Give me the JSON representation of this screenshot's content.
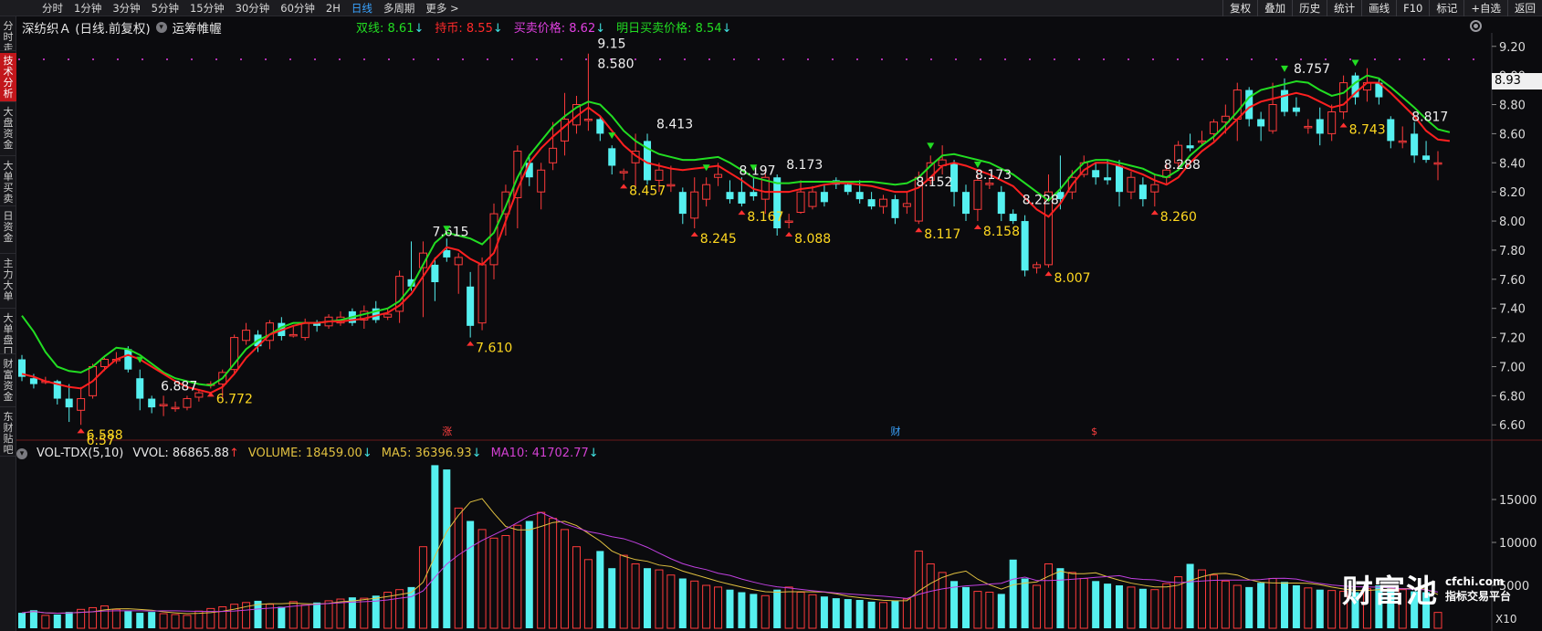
{
  "topbar": {
    "periods": [
      "分时",
      "1分钟",
      "3分钟",
      "5分钟",
      "15分钟",
      "30分钟",
      "60分钟",
      "2H",
      "日线",
      "多周期",
      "更多 >"
    ],
    "active_period": "日线",
    "tools": [
      "复权",
      "叠加",
      "历史",
      "统计",
      "画线",
      "F10",
      "标记",
      "+自选",
      "返回"
    ]
  },
  "sidebar": {
    "tabs": [
      "分时走势",
      "技术分析",
      "大盘资金",
      "大单买卖",
      "日资金",
      "主力大单",
      "大单盘口",
      "财富资金",
      "东财贴吧"
    ],
    "active": "技术分析"
  },
  "header": {
    "stock_title": "深纺织Ａ (日线.前复权)",
    "indicator_name": "运筹帷幄",
    "indicators": [
      {
        "label": "双线:",
        "value": "8.61",
        "arrow": "↓",
        "color": "#22dd22"
      },
      {
        "label": "持币:",
        "value": "8.55",
        "arrow": "↓",
        "color": "#ff2a2a"
      },
      {
        "label": "买卖价格:",
        "value": "8.62",
        "arrow": "↓",
        "color": "#e040e0"
      },
      {
        "label": "明日买卖价格:",
        "value": "8.54",
        "arrow": "↓",
        "color": "#22dd22"
      }
    ]
  },
  "volume_header": {
    "name": "VOL-TDX(5,10)",
    "vvol": "VVOL: 86865.88",
    "vvol_arrow": "↑",
    "volume": "VOLUME: 18459.00",
    "volume_arrow": "↓",
    "ma5": "MA5: 36396.93",
    "ma5_arrow": "↓",
    "ma10": "MA10: 41702.77",
    "ma10_arrow": "↓"
  },
  "current_price_tag": "8.93",
  "x10_label": "X10",
  "watermark": {
    "logo": "财富池",
    "domain": "cfchi.com",
    "subtitle": "指标交易平台"
  },
  "event_markers": [
    "涨",
    "财",
    "$"
  ],
  "colors": {
    "up": "#ff3b3b",
    "down": "#55f0f0",
    "green_line": "#22dd22",
    "red_line": "#ff2020",
    "ma5": "#e0c040",
    "ma10": "#c040e0"
  },
  "chart_data": [
    {
      "type": "candlestick",
      "title": "",
      "y_ticks": [
        "9.20",
        "9.00",
        "8.80",
        "8.60",
        "8.40",
        "8.20",
        "8.00",
        "7.80",
        "7.60",
        "7.40",
        "7.20",
        "7.00",
        "6.80",
        "6.60"
      ],
      "ylim": [
        6.52,
        9.28
      ],
      "candles": [
        [
          7.05,
          6.93,
          6.9,
          7.08
        ],
        [
          6.92,
          6.88,
          6.85,
          6.95
        ],
        [
          6.9,
          6.9,
          6.88,
          6.93
        ],
        [
          6.9,
          6.78,
          6.74,
          6.91
        ],
        [
          6.78,
          6.72,
          6.62,
          6.88
        ],
        [
          6.7,
          6.78,
          6.6,
          6.86
        ],
        [
          6.8,
          7.0,
          6.78,
          7.02
        ],
        [
          7.0,
          7.05,
          6.97,
          7.06
        ],
        [
          7.05,
          7.05,
          7.02,
          7.1
        ],
        [
          7.12,
          6.98,
          6.96,
          7.14
        ],
        [
          6.92,
          6.78,
          6.7,
          6.98
        ],
        [
          6.78,
          6.72,
          6.68,
          6.8
        ],
        [
          6.74,
          6.74,
          6.66,
          6.8
        ],
        [
          6.72,
          6.72,
          6.69,
          6.76
        ],
        [
          6.72,
          6.78,
          6.7,
          6.8
        ],
        [
          6.79,
          6.82,
          6.76,
          6.84
        ],
        [
          6.88,
          6.88,
          6.85,
          6.9
        ],
        [
          6.88,
          6.96,
          6.78,
          6.98
        ],
        [
          6.98,
          7.2,
          6.95,
          7.22
        ],
        [
          7.18,
          7.25,
          7.15,
          7.3
        ],
        [
          7.22,
          7.14,
          7.1,
          7.25
        ],
        [
          7.18,
          7.3,
          7.12,
          7.32
        ],
        [
          7.3,
          7.21,
          7.18,
          7.34
        ],
        [
          7.22,
          7.22,
          7.2,
          7.28
        ],
        [
          7.2,
          7.3,
          7.18,
          7.33
        ],
        [
          7.3,
          7.28,
          7.24,
          7.32
        ],
        [
          7.28,
          7.34,
          7.26,
          7.36
        ],
        [
          7.3,
          7.34,
          7.28,
          7.38
        ],
        [
          7.38,
          7.3,
          7.28,
          7.4
        ],
        [
          7.32,
          7.38,
          7.26,
          7.42
        ],
        [
          7.4,
          7.32,
          7.3,
          7.45
        ],
        [
          7.34,
          7.36,
          7.32,
          7.4
        ],
        [
          7.38,
          7.62,
          7.3,
          7.66
        ],
        [
          7.6,
          7.55,
          7.52,
          7.86
        ],
        [
          7.68,
          7.78,
          7.34,
          7.86
        ],
        [
          7.7,
          7.58,
          7.45,
          7.75
        ],
        [
          7.8,
          7.75,
          7.72,
          7.88
        ],
        [
          7.7,
          7.75,
          7.5,
          7.78
        ],
        [
          7.55,
          7.28,
          7.2,
          7.65
        ],
        [
          7.3,
          7.7,
          7.25,
          7.75
        ],
        [
          7.7,
          8.05,
          7.6,
          8.12
        ],
        [
          8.05,
          8.2,
          7.9,
          8.25
        ],
        [
          8.16,
          8.48,
          7.95,
          8.52
        ],
        [
          8.4,
          8.3,
          8.24,
          8.46
        ],
        [
          8.2,
          8.35,
          8.08,
          8.4
        ],
        [
          8.4,
          8.5,
          8.35,
          8.68
        ],
        [
          8.55,
          8.7,
          8.45,
          8.88
        ],
        [
          8.66,
          8.8,
          8.6,
          8.86
        ],
        [
          8.7,
          8.7,
          8.62,
          9.15
        ],
        [
          8.7,
          8.6,
          8.55,
          8.72
        ],
        [
          8.5,
          8.38,
          8.32,
          8.52
        ],
        [
          8.34,
          8.34,
          8.28,
          8.36
        ],
        [
          8.4,
          8.48,
          8.22,
          8.6
        ],
        [
          8.55,
          8.28,
          8.25,
          8.6
        ],
        [
          8.28,
          8.35,
          8.2,
          8.4
        ],
        [
          8.25,
          8.25,
          8.2,
          8.38
        ],
        [
          8.2,
          8.05,
          7.98,
          8.23
        ],
        [
          8.02,
          8.2,
          7.95,
          8.3
        ],
        [
          8.15,
          8.25,
          8.1,
          8.3
        ],
        [
          8.3,
          8.32,
          8.24,
          8.4
        ],
        [
          8.2,
          8.15,
          8.12,
          8.28
        ],
        [
          8.2,
          8.12,
          8.1,
          8.3
        ],
        [
          8.2,
          8.17,
          8.14,
          8.3
        ],
        [
          8.15,
          8.3,
          8.05,
          8.36
        ],
        [
          8.3,
          7.95,
          7.9,
          8.32
        ],
        [
          8.0,
          8.0,
          7.95,
          8.05
        ],
        [
          8.06,
          8.2,
          8.05,
          8.28
        ],
        [
          8.1,
          8.2,
          8.08,
          8.24
        ],
        [
          8.2,
          8.13,
          8.1,
          8.25
        ],
        [
          8.28,
          8.25,
          8.22,
          8.3
        ],
        [
          8.25,
          8.2,
          8.18,
          8.27
        ],
        [
          8.2,
          8.15,
          8.12,
          8.28
        ],
        [
          8.15,
          8.1,
          8.08,
          8.2
        ],
        [
          8.1,
          8.15,
          8.05,
          8.18
        ],
        [
          8.15,
          8.02,
          7.98,
          8.18
        ],
        [
          8.1,
          8.12,
          8.05,
          8.2
        ],
        [
          8.0,
          8.3,
          7.98,
          8.34
        ],
        [
          8.28,
          8.4,
          8.25,
          8.45
        ],
        [
          8.38,
          8.42,
          8.32,
          8.52
        ],
        [
          8.4,
          8.2,
          8.1,
          8.42
        ],
        [
          8.2,
          8.05,
          8.0,
          8.25
        ],
        [
          8.08,
          8.28,
          8.0,
          8.32
        ],
        [
          8.25,
          8.26,
          8.22,
          8.3
        ],
        [
          8.2,
          8.05,
          8.0,
          8.24
        ],
        [
          8.05,
          8.0,
          7.98,
          8.08
        ],
        [
          8.0,
          7.66,
          7.62,
          8.04
        ],
        [
          7.68,
          7.7,
          7.64,
          7.72
        ],
        [
          7.7,
          8.2,
          7.68,
          8.32
        ],
        [
          8.2,
          8.15,
          8.08,
          8.45
        ],
        [
          8.2,
          8.3,
          8.15,
          8.35
        ],
        [
          8.32,
          8.4,
          8.3,
          8.45
        ],
        [
          8.35,
          8.3,
          8.25,
          8.4
        ],
        [
          8.3,
          8.28,
          8.25,
          8.42
        ],
        [
          8.38,
          8.2,
          8.1,
          8.42
        ],
        [
          8.2,
          8.3,
          8.15,
          8.34
        ],
        [
          8.25,
          8.15,
          8.1,
          8.3
        ],
        [
          8.2,
          8.25,
          8.1,
          8.32
        ],
        [
          8.3,
          8.35,
          8.25,
          8.4
        ],
        [
          8.4,
          8.52,
          8.35,
          8.55
        ],
        [
          8.52,
          8.5,
          8.48,
          8.6
        ],
        [
          8.55,
          8.55,
          8.52,
          8.62
        ],
        [
          8.6,
          8.68,
          8.55,
          8.7
        ],
        [
          8.68,
          8.72,
          8.6,
          8.8
        ],
        [
          8.7,
          8.9,
          8.55,
          8.95
        ],
        [
          8.9,
          8.7,
          8.65,
          8.92
        ],
        [
          8.7,
          8.65,
          8.55,
          8.75
        ],
        [
          8.62,
          8.8,
          8.6,
          8.95
        ],
        [
          8.9,
          8.75,
          8.72,
          8.98
        ],
        [
          8.78,
          8.75,
          8.72,
          8.85
        ],
        [
          8.65,
          8.65,
          8.6,
          8.7
        ],
        [
          8.7,
          8.6,
          8.52,
          8.78
        ],
        [
          8.6,
          8.75,
          8.55,
          8.8
        ],
        [
          8.75,
          8.95,
          8.7,
          9.0
        ],
        [
          9.0,
          8.85,
          8.8,
          9.02
        ],
        [
          8.9,
          8.95,
          8.82,
          9.05
        ],
        [
          8.95,
          8.85,
          8.8,
          8.98
        ],
        [
          8.7,
          8.55,
          8.5,
          8.72
        ],
        [
          8.55,
          8.55,
          8.5,
          8.65
        ],
        [
          8.6,
          8.45,
          8.4,
          8.68
        ],
        [
          8.45,
          8.42,
          8.4,
          8.55
        ],
        [
          8.4,
          8.4,
          8.28,
          8.48
        ]
      ],
      "green_line": [
        7.35,
        7.24,
        7.1,
        7.0,
        6.97,
        6.96,
        7.0,
        7.07,
        7.13,
        7.12,
        7.08,
        7.02,
        6.96,
        6.92,
        6.9,
        6.88,
        6.87,
        6.92,
        7.02,
        7.12,
        7.18,
        7.22,
        7.27,
        7.3,
        7.3,
        7.3,
        7.31,
        7.32,
        7.34,
        7.36,
        7.38,
        7.4,
        7.45,
        7.55,
        7.7,
        7.85,
        7.92,
        7.9,
        7.88,
        7.84,
        7.92,
        8.1,
        8.3,
        8.45,
        8.55,
        8.65,
        8.72,
        8.78,
        8.82,
        8.8,
        8.72,
        8.62,
        8.55,
        8.5,
        8.46,
        8.44,
        8.42,
        8.42,
        8.43,
        8.44,
        8.4,
        8.35,
        8.3,
        8.28,
        8.26,
        8.26,
        8.27,
        8.27,
        8.27,
        8.27,
        8.27,
        8.27,
        8.27,
        8.26,
        8.25,
        8.26,
        8.3,
        8.38,
        8.45,
        8.46,
        8.44,
        8.42,
        8.4,
        8.36,
        8.32,
        8.26,
        8.2,
        8.14,
        8.22,
        8.32,
        8.4,
        8.42,
        8.42,
        8.4,
        8.38,
        8.36,
        8.32,
        8.3,
        8.35,
        8.45,
        8.52,
        8.58,
        8.66,
        8.75,
        8.85,
        8.9,
        8.92,
        8.94,
        8.96,
        8.95,
        8.9,
        8.86,
        8.88,
        8.95,
        9.0,
        8.98,
        8.92,
        8.85,
        8.78,
        8.7,
        8.63,
        8.61
      ],
      "red_line": [
        6.95,
        6.93,
        6.9,
        6.88,
        6.86,
        6.85,
        6.9,
        6.98,
        7.05,
        7.08,
        7.05,
        7.0,
        6.95,
        6.9,
        6.86,
        6.84,
        6.82,
        6.86,
        6.95,
        7.06,
        7.14,
        7.22,
        7.25,
        7.28,
        7.3,
        7.3,
        7.31,
        7.31,
        7.32,
        7.33,
        7.35,
        7.37,
        7.42,
        7.5,
        7.62,
        7.74,
        7.82,
        7.8,
        7.74,
        7.7,
        7.78,
        8.0,
        8.22,
        8.4,
        8.5,
        8.58,
        8.65,
        8.72,
        8.78,
        8.72,
        8.62,
        8.52,
        8.45,
        8.4,
        8.38,
        8.36,
        8.35,
        8.36,
        8.37,
        8.38,
        8.33,
        8.28,
        8.22,
        8.2,
        8.2,
        8.2,
        8.22,
        8.23,
        8.25,
        8.26,
        8.26,
        8.25,
        8.24,
        8.22,
        8.2,
        8.2,
        8.23,
        8.3,
        8.38,
        8.4,
        8.38,
        8.35,
        8.32,
        8.28,
        8.24,
        8.16,
        8.08,
        8.03,
        8.12,
        8.25,
        8.35,
        8.4,
        8.4,
        8.38,
        8.35,
        8.32,
        8.28,
        8.25,
        8.3,
        8.4,
        8.48,
        8.54,
        8.62,
        8.7,
        8.78,
        8.82,
        8.84,
        8.86,
        8.88,
        8.86,
        8.82,
        8.78,
        8.8,
        8.88,
        8.95,
        8.95,
        8.88,
        8.8,
        8.72,
        8.62,
        8.56,
        8.55
      ],
      "high_annotations": [
        {
          "i": 11,
          "label": "6.887"
        },
        {
          "i": 34,
          "label": "7.615"
        },
        {
          "i": 48,
          "label": "9.15"
        },
        {
          "i": 48,
          "label": "8.580",
          "alt": true
        },
        {
          "i": 53,
          "label": "8.413"
        },
        {
          "i": 60,
          "label": "8.197"
        },
        {
          "i": 64,
          "label": "8.173"
        },
        {
          "i": 75,
          "label": "8.152"
        },
        {
          "i": 80,
          "label": "8.173"
        },
        {
          "i": 84,
          "label": "8.228"
        },
        {
          "i": 96,
          "label": "8.288"
        },
        {
          "i": 107,
          "label": "8.757"
        },
        {
          "i": 117,
          "label": "8.817"
        }
      ],
      "low_annotations": [
        {
          "i": 5,
          "label": "6.588"
        },
        {
          "i": 5,
          "label": "6.57",
          "alt": true
        },
        {
          "i": 16,
          "label": "6.772"
        },
        {
          "i": 38,
          "label": "7.610"
        },
        {
          "i": 51,
          "label": "8.457"
        },
        {
          "i": 57,
          "label": "8.245"
        },
        {
          "i": 61,
          "label": "8.167"
        },
        {
          "i": 65,
          "label": "8.088"
        },
        {
          "i": 76,
          "label": "8.117"
        },
        {
          "i": 81,
          "label": "8.158"
        },
        {
          "i": 87,
          "label": "8.007"
        },
        {
          "i": 96,
          "label": "8.260"
        },
        {
          "i": 112,
          "label": "8.743"
        }
      ]
    },
    {
      "type": "bar",
      "title": "VOL-TDX(5,10)",
      "y_ticks": [
        "15000",
        "10000",
        "5000"
      ],
      "ylim": [
        0,
        20000
      ],
      "volumes": [
        1800,
        2100,
        1500,
        1600,
        1900,
        2200,
        2400,
        2600,
        2200,
        2000,
        1800,
        1900,
        1700,
        1600,
        1500,
        2000,
        2300,
        2500,
        2800,
        3000,
        3200,
        2800,
        2500,
        3100,
        2700,
        3000,
        3200,
        3400,
        3600,
        3500,
        3800,
        4200,
        4500,
        4800,
        9500,
        19000,
        18500,
        14000,
        12500,
        11500,
        10500,
        10800,
        12000,
        12500,
        13500,
        12800,
        11500,
        9500,
        8000,
        9000,
        7000,
        8500,
        7500,
        7000,
        6800,
        6200,
        5800,
        5500,
        5000,
        4800,
        4500,
        4200,
        4000,
        3800,
        4500,
        4800,
        4200,
        3900,
        3700,
        3500,
        3400,
        3300,
        3100,
        3000,
        3200,
        3400,
        9000,
        7500,
        6500,
        5500,
        4800,
        4300,
        4200,
        4000,
        8000,
        5800,
        5000,
        7500,
        7000,
        6500,
        5800,
        5500,
        5200,
        5000,
        4800,
        4600,
        4500,
        5200,
        6000,
        7500,
        6800,
        6200,
        5500,
        5000,
        4800,
        5300,
        5800,
        5400,
        5000,
        4700,
        4500,
        4400,
        4300,
        4200,
        4600,
        5000,
        4800,
        4500,
        4300,
        4200,
        1846
      ],
      "ma5": "computed",
      "ma10": "computed"
    }
  ]
}
